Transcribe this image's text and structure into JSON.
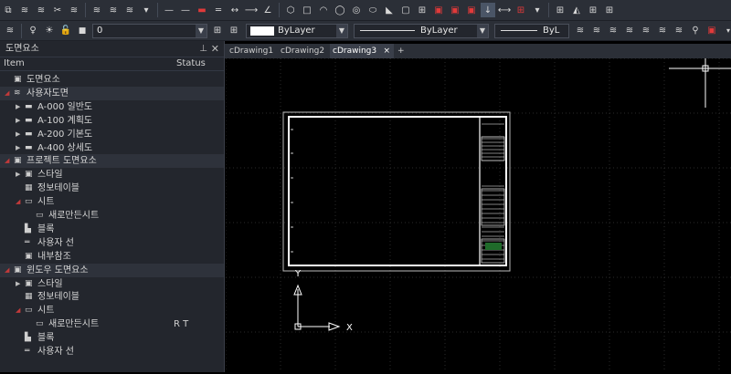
{
  "toolbar2": {
    "layer_value": "0",
    "color_value": "ByLayer",
    "linetype_value": "ByLayer",
    "lineweight_value": "ByL"
  },
  "panel": {
    "title": "도면요소",
    "col_item": "Item",
    "col_status": "Status",
    "tree": [
      {
        "label": "도면요소",
        "indent": 0,
        "arrow": "",
        "icon": "doc",
        "status": ""
      },
      {
        "label": "사용자도면",
        "indent": 0,
        "arrow": "down",
        "icon": "stack",
        "status": "",
        "group": true
      },
      {
        "label": "A-000 일반도",
        "indent": 1,
        "arrow": "right",
        "icon": "folder",
        "status": ""
      },
      {
        "label": "A-100 계획도",
        "indent": 1,
        "arrow": "right",
        "icon": "folder",
        "status": ""
      },
      {
        "label": "A-200 기본도",
        "indent": 1,
        "arrow": "right",
        "icon": "folder",
        "status": ""
      },
      {
        "label": "A-400 상세도",
        "indent": 1,
        "arrow": "right",
        "icon": "folder",
        "status": ""
      },
      {
        "label": "프로젝트 도면요소",
        "indent": 0,
        "arrow": "down",
        "icon": "proj",
        "status": "",
        "group": true
      },
      {
        "label": "스타일",
        "indent": 1,
        "arrow": "right",
        "icon": "style",
        "status": ""
      },
      {
        "label": "정보테이블",
        "indent": 1,
        "arrow": "",
        "icon": "table",
        "status": ""
      },
      {
        "label": "시트",
        "indent": 1,
        "arrow": "down",
        "icon": "sheet",
        "status": ""
      },
      {
        "label": "새로만든시트",
        "indent": 2,
        "arrow": "",
        "icon": "sheetitem",
        "status": ""
      },
      {
        "label": "블록",
        "indent": 1,
        "arrow": "",
        "icon": "block",
        "status": ""
      },
      {
        "label": "사용자 선",
        "indent": 1,
        "arrow": "",
        "icon": "line",
        "status": ""
      },
      {
        "label": "내부참조",
        "indent": 1,
        "arrow": "",
        "icon": "xref",
        "status": ""
      },
      {
        "label": "윈도우 도면요소",
        "indent": 0,
        "arrow": "down",
        "icon": "proj",
        "status": "",
        "group": true
      },
      {
        "label": "스타일",
        "indent": 1,
        "arrow": "right",
        "icon": "style",
        "status": ""
      },
      {
        "label": "정보테이블",
        "indent": 1,
        "arrow": "",
        "icon": "table",
        "status": ""
      },
      {
        "label": "시트",
        "indent": 1,
        "arrow": "down",
        "icon": "sheet",
        "status": ""
      },
      {
        "label": "새로만든시트",
        "indent": 2,
        "arrow": "",
        "icon": "sheetitem",
        "status": "R T"
      },
      {
        "label": "블록",
        "indent": 1,
        "arrow": "",
        "icon": "block",
        "status": ""
      },
      {
        "label": "사용자 선",
        "indent": 1,
        "arrow": "",
        "icon": "line",
        "status": ""
      }
    ]
  },
  "tabs": [
    {
      "label": "cDrawing1",
      "active": false
    },
    {
      "label": "cDrawing2",
      "active": false
    },
    {
      "label": "cDrawing3",
      "active": true
    }
  ],
  "tab_close": "×",
  "tab_add": "+",
  "ucs": {
    "x_label": "X",
    "y_label": "Y"
  },
  "colors": {
    "accent_red": "#e03a3a",
    "grid": "#2a2a2a",
    "canvas": "#000000"
  }
}
